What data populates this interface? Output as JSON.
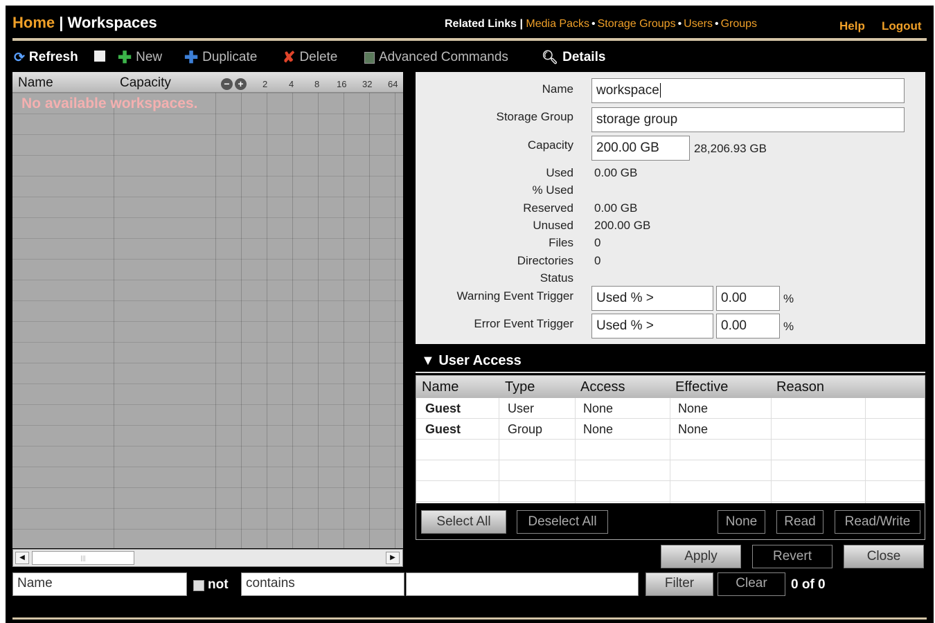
{
  "header": {
    "home": "Home",
    "separator": " | ",
    "current": "Workspaces",
    "related_label": "Related Links |",
    "links": [
      "Media Packs",
      "Storage Groups",
      "Users",
      "Groups"
    ],
    "help": "Help",
    "logout": "Logout"
  },
  "toolbar": {
    "refresh": "Refresh",
    "new": "New",
    "duplicate": "Duplicate",
    "delete": "Delete",
    "advanced": "Advanced Commands",
    "details": "Details",
    "icons": {
      "refresh": "refresh-icon",
      "stop": "stop-icon",
      "new": "plus-icon",
      "duplicate": "plus-icon",
      "delete": "x-icon",
      "advanced": "terminal-icon",
      "details": "magnifier-icon"
    }
  },
  "grid": {
    "col_name": "Name",
    "col_capacity": "Capacity",
    "zoom_out": "−",
    "zoom_in": "+",
    "ticks": [
      "2",
      "4",
      "8",
      "16",
      "32",
      "64"
    ],
    "empty_message": "No available workspaces."
  },
  "filter": {
    "field": "Name",
    "not_label": "not",
    "operator": "contains",
    "value": "",
    "filter_button": "Filter",
    "clear_button": "Clear",
    "count": "0 of 0"
  },
  "details": {
    "name_label": "Name",
    "name_value": "workspace",
    "storage_label": "Storage Group",
    "storage_value": "storage group",
    "capacity_label": "Capacity",
    "capacity_value": "200.00 GB",
    "capacity_available": "28,206.93 GB",
    "used_label": "Used",
    "used_value": "0.00 GB",
    "pct_used_label": "% Used",
    "reserved_label": "Reserved",
    "reserved_value": "0.00 GB",
    "unused_label": "Unused",
    "unused_value": "200.00 GB",
    "files_label": "Files",
    "files_value": "0",
    "dirs_label": "Directories",
    "dirs_value": "0",
    "status_label": "Status",
    "warning_label": "Warning Event Trigger",
    "warning_condition": "Used % >",
    "warning_value": "0.00",
    "error_label": "Error Event Trigger",
    "error_condition": "Used % >",
    "error_value": "0.00",
    "percent_sign": "%"
  },
  "user_access": {
    "title": "User Access",
    "columns": [
      "Name",
      "Type",
      "Access",
      "Effective",
      "Reason"
    ],
    "rows": [
      {
        "name": "Guest",
        "type": "User",
        "access": "None",
        "effective": "None",
        "reason": ""
      },
      {
        "name": "Guest",
        "type": "Group",
        "access": "None",
        "effective": "None",
        "reason": ""
      }
    ],
    "select_all": "Select All",
    "deselect_all": "Deselect All",
    "none": "None",
    "read": "Read",
    "read_write": "Read/Write"
  },
  "actions": {
    "apply": "Apply",
    "revert": "Revert",
    "close": "Close"
  },
  "colors": {
    "accent": "#f0a028",
    "background": "#000000",
    "panel": "#ececec",
    "grid": "#a9a9a9",
    "empty_text": "#f4b0b0"
  }
}
